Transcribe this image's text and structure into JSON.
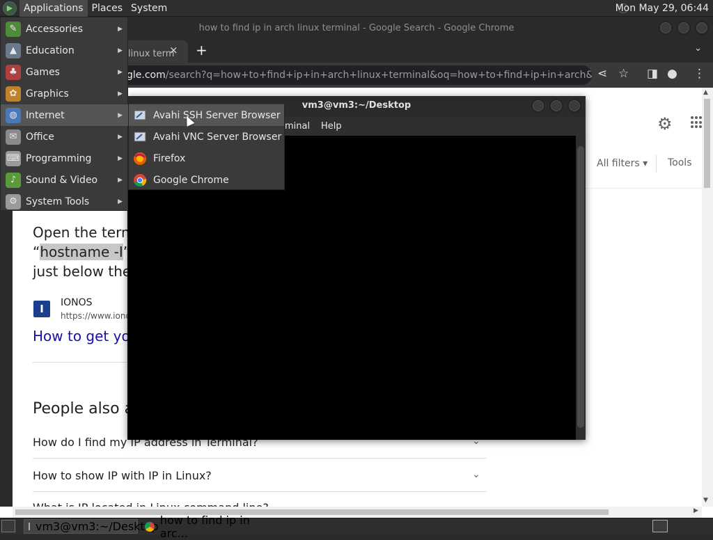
{
  "top_panel": {
    "menus": [
      "Applications",
      "Places",
      "System"
    ],
    "clock": "Mon May 29, 06:44"
  },
  "chrome": {
    "window_title": "how to find ip in arch linux terminal - Google Search - Google Chrome",
    "tab_label": "linux term",
    "tab_close": "×",
    "new_tab": "+",
    "tab_menu": "⌄",
    "url_host": "gle.com",
    "url_rest": "/search?q=how+to+find+ip+in+arch+linux+terminal&oq=how+to+find+ip+in+arch&aqs=chrome...."
  },
  "search_page": {
    "all_filters": "All filters",
    "tools": "Tools",
    "snippet_line1": "Open the termi",
    "snippet_line2_hl": "hostname -I",
    "snippet_line2_pre": "“",
    "snippet_line2_post": "” a",
    "snippet_line3": "just below the c",
    "source_logo": "I",
    "source_name": "IONOS",
    "source_url": "https://www.ionos",
    "result_link": "How to get you",
    "paa_title": "People also as",
    "paa_questions": [
      "How do I find my IP address in Terminal?",
      "How to show IP with IP in Linux?",
      "What is IP located in Linux command line?"
    ]
  },
  "terminal": {
    "title": "vm3@vm3:~/Desktop",
    "menu_terminal": "minal",
    "menu_help": "Help"
  },
  "apps_menu": {
    "items": [
      {
        "label": "Accessories",
        "icon": "accessories-icon",
        "color": "#4f8a3c"
      },
      {
        "label": "Education",
        "icon": "education-icon",
        "color": "#6a7a8a"
      },
      {
        "label": "Games",
        "icon": "games-icon",
        "color": "#b04040"
      },
      {
        "label": "Graphics",
        "icon": "graphics-icon",
        "color": "#c0822a"
      },
      {
        "label": "Internet",
        "icon": "internet-icon",
        "color": "#4a78b8"
      },
      {
        "label": "Office",
        "icon": "office-icon",
        "color": "#8a8a8a"
      },
      {
        "label": "Programming",
        "icon": "programming-icon",
        "color": "#9a9a9a"
      },
      {
        "label": "Sound & Video",
        "icon": "sound-video-icon",
        "color": "#5a9a3a"
      },
      {
        "label": "System Tools",
        "icon": "system-tools-icon",
        "color": "#9a9a9a"
      }
    ],
    "highlighted": "Internet"
  },
  "internet_submenu": {
    "items": [
      {
        "label": "Avahi SSH Server Browser",
        "icon": "avahi-ssh-icon"
      },
      {
        "label": "Avahi VNC Server Browser",
        "icon": "avahi-vnc-icon"
      },
      {
        "label": "Firefox",
        "icon": "firefox-icon"
      },
      {
        "label": "Google Chrome",
        "icon": "chrome-icon"
      }
    ],
    "highlighted": "Avahi SSH Server Browser"
  },
  "taskbar": {
    "tasks": [
      "vm3@vm3:~/Desktop",
      "how to find ip in arc..."
    ]
  }
}
